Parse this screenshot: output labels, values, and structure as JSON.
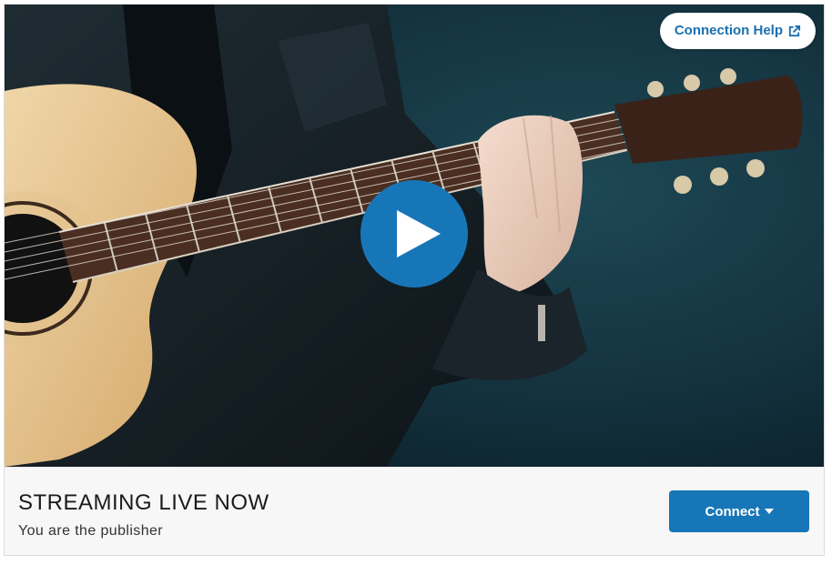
{
  "player": {
    "help_label": "Connection Help",
    "help_icon": "external-link-icon",
    "play_icon": "play-icon"
  },
  "stream": {
    "title": "STREAMING LIVE NOW",
    "subtitle": "You are the publisher",
    "connect_label": "Connect",
    "connect_icon": "caret-down-icon"
  },
  "colors": {
    "accent": "#1776b8",
    "footer_bg": "#f7f7f7"
  }
}
